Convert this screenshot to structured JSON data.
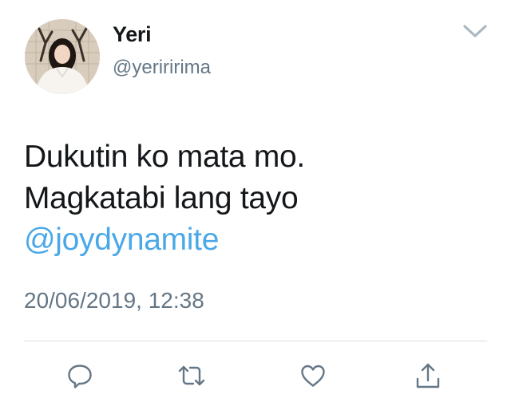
{
  "tweet": {
    "author": {
      "display_name": "Yeri",
      "handle": "@yeriririma",
      "avatar": "avatar-photo"
    },
    "text_line_1": "Dukutin ko mata mo.",
    "text_line_2": "Magkatabi lang tayo",
    "mention": "@joydynamite",
    "timestamp": "20/06/2019, 12:38"
  },
  "icons": {
    "menu": "chevron-down-icon",
    "reply": "reply-icon",
    "retweet": "retweet-icon",
    "like": "heart-icon",
    "share": "share-icon"
  },
  "colors": {
    "text": "#14171a",
    "secondary": "#657786",
    "link": "#4aa8e8",
    "divider": "#d7dde2"
  }
}
